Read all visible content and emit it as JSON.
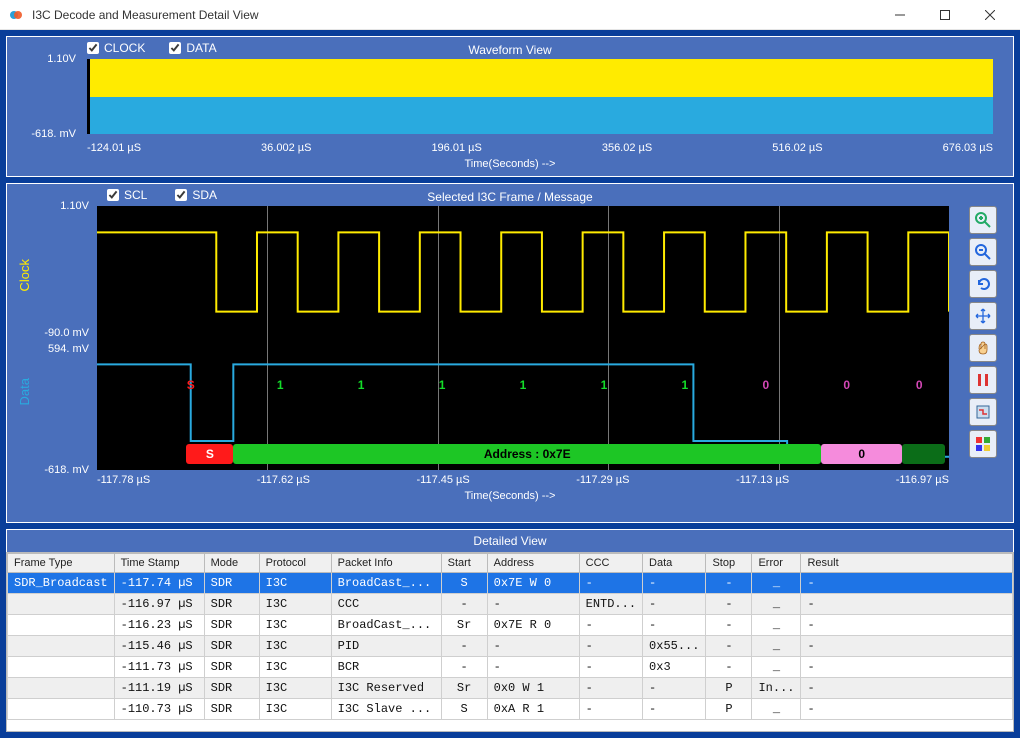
{
  "window": {
    "title": "I3C Decode and Measurement Detail View"
  },
  "waveform": {
    "title": "Waveform View",
    "legend": {
      "clock": "CLOCK",
      "data": "DATA"
    },
    "y": {
      "top": "1.10V",
      "bottom": "-618. mV"
    },
    "x": {
      "ticks": [
        "-124.01 µS",
        "36.002 µS",
        "196.01 µS",
        "356.02 µS",
        "516.02 µS",
        "676.03 µS"
      ],
      "label": "Time(Seconds) -->"
    }
  },
  "frame": {
    "title": "Selected I3C Frame / Message",
    "legend": {
      "scl": "SCL",
      "sda": "SDA"
    },
    "vlabels": {
      "clock": "Clock",
      "data": "Data"
    },
    "y": {
      "top": "1.10V",
      "mid1": "-90.0 mV",
      "mid2": "594. mV",
      "bottom": "-618. mV"
    },
    "x": {
      "ticks": [
        "-117.78 µS",
        "-117.62 µS",
        "-117.45 µS",
        "-117.29 µS",
        "-117.13 µS",
        "-116.97 µS"
      ],
      "label": "Time(Seconds) -->"
    },
    "bits": [
      "S",
      "1",
      "1",
      "1",
      "1",
      "1",
      "1",
      "0",
      "0",
      "0"
    ],
    "bus": {
      "start": "S",
      "address": "Address : 0x7E",
      "rw": "0"
    }
  },
  "chart_data": {
    "type": "line",
    "title": "Selected I3C Frame / Message",
    "xlabel": "Time(Seconds) -->",
    "x_ticks_us": [
      -117.78,
      -117.62,
      -117.45,
      -117.29,
      -117.13,
      -116.97
    ],
    "ylim_v": [
      -0.618,
      1.1
    ],
    "series": [
      {
        "name": "SCL (Clock)",
        "color": "#ffeb00",
        "pattern": "square-wave",
        "periods": 9
      },
      {
        "name": "SDA (Data)",
        "color": "#29aadf",
        "bits": [
          "S",
          "1",
          "1",
          "1",
          "1",
          "1",
          "1",
          "0",
          "0",
          "0"
        ]
      }
    ],
    "decoded_bus": [
      {
        "label": "S",
        "color": "red",
        "range_pct": [
          10.5,
          16
        ]
      },
      {
        "label": "Address : 0x7E",
        "color": "green",
        "range_pct": [
          16,
          85
        ]
      },
      {
        "label": "0",
        "color": "pink",
        "range_pct": [
          85,
          94.5
        ]
      }
    ],
    "overview": {
      "title": "Waveform View",
      "x_ticks_us": [
        -124.01,
        36.002,
        196.01,
        356.02,
        516.02,
        676.03
      ],
      "ylim_v": [
        -0.618,
        1.1
      ]
    }
  },
  "toolbar": {
    "zoom_in": "Zoom In",
    "zoom_out": "Zoom Out",
    "undo": "Undo",
    "pan": "Pan",
    "hand": "Hand",
    "pause": "Pause",
    "marker": "Marker",
    "color": "Color"
  },
  "detail": {
    "title": "Detailed View",
    "columns": [
      "Frame Type",
      "Time Stamp",
      "Mode",
      "Protocol",
      "Packet Info",
      "Start",
      "Address",
      "CCC",
      "Data",
      "Stop",
      "Error",
      "Result"
    ],
    "rows": [
      {
        "frame": "SDR_Broadcast",
        "time": "-117.74 µS",
        "mode": "SDR",
        "proto": "I3C",
        "pkt": "BroadCast_...",
        "start": "S",
        "addr": "0x7E W 0",
        "ccc": "-",
        "data": "-",
        "stop": "-",
        "err": "_",
        "res": "-",
        "selected": true
      },
      {
        "frame": "",
        "time": "-116.97 µS",
        "mode": "SDR",
        "proto": "I3C",
        "pkt": "CCC",
        "start": "-",
        "addr": "-",
        "ccc": "ENTD...",
        "data": "-",
        "stop": "-",
        "err": "_",
        "res": "-"
      },
      {
        "frame": "",
        "time": "-116.23 µS",
        "mode": "SDR",
        "proto": "I3C",
        "pkt": "BroadCast_...",
        "start": "Sr",
        "addr": "0x7E R 0",
        "ccc": "-",
        "data": "-",
        "stop": "-",
        "err": "_",
        "res": "-"
      },
      {
        "frame": "",
        "time": "-115.46 µS",
        "mode": "SDR",
        "proto": "I3C",
        "pkt": "PID",
        "start": "-",
        "addr": "-",
        "ccc": "-",
        "data": "0x55...",
        "stop": "-",
        "err": "_",
        "res": "-"
      },
      {
        "frame": "",
        "time": "-111.73 µS",
        "mode": "SDR",
        "proto": "I3C",
        "pkt": "BCR",
        "start": "-",
        "addr": "-",
        "ccc": "-",
        "data": "0x3",
        "stop": "-",
        "err": "_",
        "res": "-"
      },
      {
        "frame": "",
        "time": "-111.19 µS",
        "mode": "SDR",
        "proto": "I3C",
        "pkt": "I3C Reserved",
        "start": "Sr",
        "addr": "0x0 W 1",
        "ccc": "-",
        "data": "-",
        "stop": "P",
        "err": "In...",
        "res": "-"
      },
      {
        "frame": "",
        "time": "-110.73 µS",
        "mode": "SDR",
        "proto": "I3C",
        "pkt": "I3C Slave ...",
        "start": "S",
        "addr": "0xA R 1",
        "ccc": "-",
        "data": "-",
        "stop": "P",
        "err": "_",
        "res": "-"
      }
    ]
  }
}
